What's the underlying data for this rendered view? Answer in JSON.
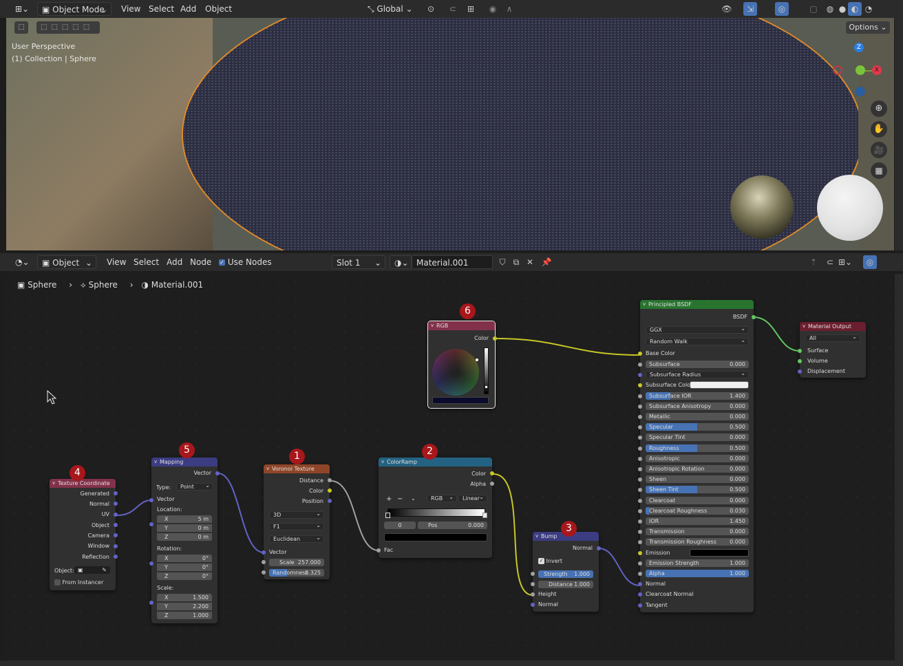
{
  "top_header": {
    "mode": "Object Mode",
    "menus": [
      "View",
      "Select",
      "Add",
      "Object"
    ],
    "orientation": "Global",
    "options": "Options"
  },
  "viewport": {
    "perspective": "User Perspective",
    "collection": "(1) Collection | Sphere",
    "gizmo": {
      "z": "Z",
      "x": "X"
    }
  },
  "node_header": {
    "object": "Object",
    "menus": [
      "View",
      "Select",
      "Add",
      "Node"
    ],
    "use_nodes": "Use Nodes",
    "slot": "Slot 1",
    "material": "Material.001"
  },
  "breadcrumb": [
    "Sphere",
    "Sphere",
    "Material.001"
  ],
  "badges": [
    "1",
    "2",
    "3",
    "4",
    "5",
    "6"
  ],
  "nodes": {
    "texcoord": {
      "title": "Texture Coordinate",
      "outputs": [
        "Generated",
        "Normal",
        "UV",
        "Object",
        "Camera",
        "Window",
        "Reflection"
      ],
      "object_label": "Object:",
      "from_instancer": "From Instancer"
    },
    "mapping": {
      "title": "Mapping",
      "vector_out": "Vector",
      "type_label": "Type:",
      "type_value": "Point",
      "vector_in": "Vector",
      "location": "Location:",
      "loc": [
        [
          "X",
          "5 m"
        ],
        [
          "Y",
          "0 m"
        ],
        [
          "Z",
          "0 m"
        ]
      ],
      "rotation": "Rotation:",
      "rot": [
        [
          "X",
          "0°"
        ],
        [
          "Y",
          "0°"
        ],
        [
          "Z",
          "0°"
        ]
      ],
      "scale": "Scale:",
      "scl": [
        [
          "X",
          "1.500"
        ],
        [
          "Y",
          "2.200"
        ],
        [
          "Z",
          "1.000"
        ]
      ]
    },
    "voronoi": {
      "title": "Voronoi Texture",
      "outputs": [
        "Distance",
        "Color",
        "Position"
      ],
      "dims": "3D",
      "feature": "F1",
      "metric": "Euclidean",
      "vector": "Vector",
      "scale_label": "Scale",
      "scale_value": "257.000",
      "rand_label": "Randomness",
      "rand_value": "0.325",
      "rand_fraction": 0.325
    },
    "colorramp": {
      "title": "ColorRamp",
      "outputs": [
        "Color",
        "Alpha"
      ],
      "plus": "+",
      "minus": "−",
      "color_mode": "RGB",
      "interp": "Linear",
      "index": "0",
      "pos_label": "Pos",
      "pos_value": "0.000",
      "fac": "Fac"
    },
    "bump": {
      "title": "Bump",
      "normal_out": "Normal",
      "invert": "Invert",
      "strength_label": "Strength",
      "strength_value": "1.000",
      "distance_label": "Distance",
      "distance_value": "1.000",
      "height": "Height",
      "normal_in": "Normal"
    },
    "rgb": {
      "title": "RGB",
      "color_out": "Color"
    },
    "bsdf": {
      "title": "Principled BSDF",
      "out": "BSDF",
      "distribution": "GGX",
      "sss_method": "Random Walk",
      "base_color": "Base Color",
      "fields": [
        {
          "label": "Subsurface",
          "value": "0.000",
          "fill": 0
        },
        {
          "label": "Subsurface Radius",
          "value": "",
          "fill": 0,
          "dropdown": true
        },
        {
          "label": "Subsurface Color",
          "value": "",
          "fill": 0,
          "color": "#f0f0f0"
        },
        {
          "label": "Subsurface IOR",
          "value": "1.400",
          "fill": 0.24
        },
        {
          "label": "Subsurface Anisotropy",
          "value": "0.000",
          "fill": 0
        },
        {
          "label": "Metallic",
          "value": "0.000",
          "fill": 0
        },
        {
          "label": "Specular",
          "value": "0.500",
          "fill": 0.5
        },
        {
          "label": "Specular Tint",
          "value": "0.000",
          "fill": 0
        },
        {
          "label": "Roughness",
          "value": "0.500",
          "fill": 0.5
        },
        {
          "label": "Anisotropic",
          "value": "0.000",
          "fill": 0
        },
        {
          "label": "Anisotropic Rotation",
          "value": "0.000",
          "fill": 0
        },
        {
          "label": "Sheen",
          "value": "0.000",
          "fill": 0
        },
        {
          "label": "Sheen Tint",
          "value": "0.500",
          "fill": 0.5
        },
        {
          "label": "Clearcoat",
          "value": "0.000",
          "fill": 0
        },
        {
          "label": "Clearcoat Roughness",
          "value": "0.030",
          "fill": 0.03
        },
        {
          "label": "IOR",
          "value": "1.450",
          "fill": 0
        },
        {
          "label": "Transmission",
          "value": "0.000",
          "fill": 0
        },
        {
          "label": "Transmission Roughness",
          "value": "0.000",
          "fill": 0
        },
        {
          "label": "Emission",
          "value": "",
          "fill": 0,
          "color": "#000000"
        },
        {
          "label": "Emission Strength",
          "value": "1.000",
          "fill": 0
        },
        {
          "label": "Alpha",
          "value": "1.000",
          "fill": 1.0
        },
        {
          "label": "Normal",
          "value": "",
          "fill": 0,
          "socket_only": true
        },
        {
          "label": "Clearcoat Normal",
          "value": "",
          "fill": 0,
          "socket_only": true
        },
        {
          "label": "Tangent",
          "value": "",
          "fill": 0,
          "socket_only": true
        }
      ]
    },
    "output": {
      "title": "Material Output",
      "target": "All",
      "inputs": [
        "Surface",
        "Volume",
        "Displacement"
      ]
    }
  },
  "colors": {
    "accent": "#4772b3",
    "texture_header": "#8f4628",
    "converter_header": "#246283",
    "vector_header": "#3c3c83",
    "input_header": "#83314a",
    "shader_header": "#28742f",
    "output_header": "#6b1e2f",
    "badge": "#a8171b"
  }
}
